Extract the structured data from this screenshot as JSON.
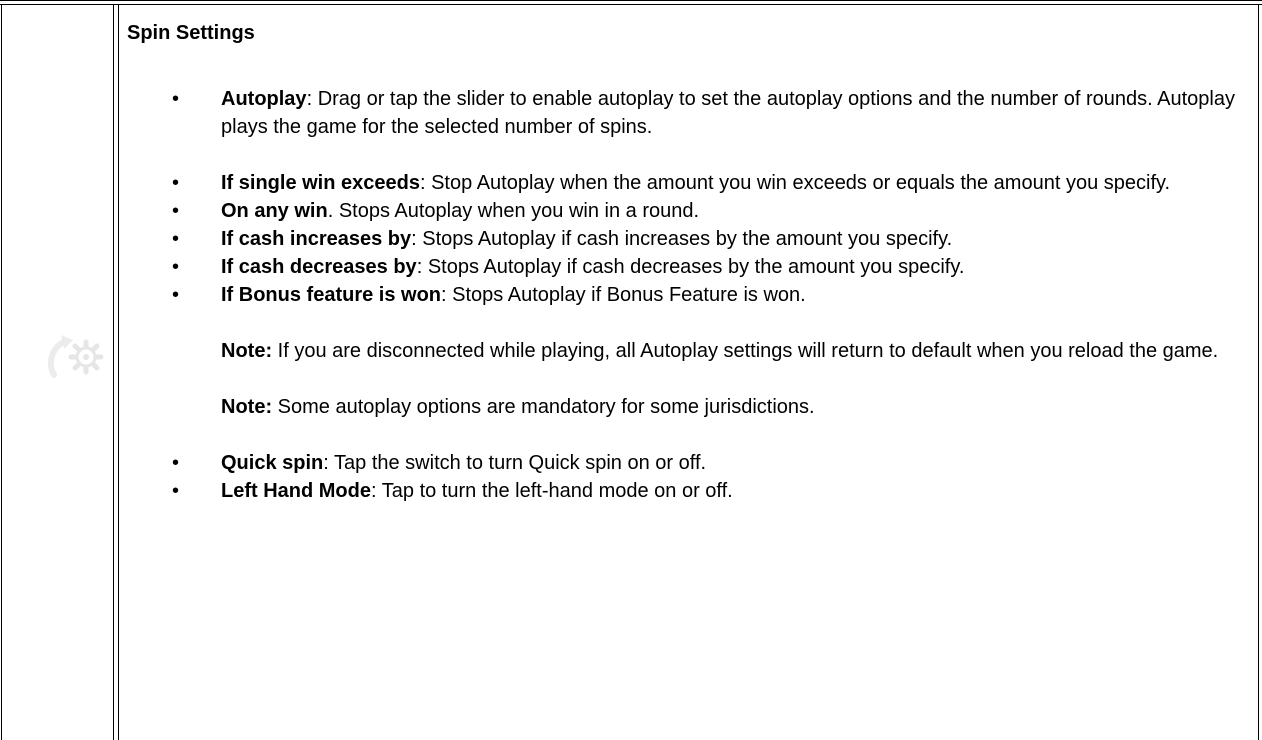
{
  "section": {
    "title": "Spin Settings",
    "icon": "autoplay-gear-icon"
  },
  "items_group1": [
    {
      "term": "Autoplay",
      "sep": ": ",
      "text": "Drag or tap the slider to enable autoplay to set the autoplay options and the number of rounds. Autoplay plays the game for the selected number of spins."
    }
  ],
  "items_group2": [
    {
      "term": "If single win exceeds",
      "sep": ": ",
      "text": "Stop Autoplay when the amount you win exceeds or equals the amount you specify."
    },
    {
      "term": "On any win",
      "sep": ". ",
      "text": "Stops Autoplay when you win in a round."
    },
    {
      "term": "If cash increases by",
      "sep": ": ",
      "text": "Stops Autoplay if cash increases by the amount you specify."
    },
    {
      "term": "If cash decreases by",
      "sep": ": ",
      "text": "Stops Autoplay if cash decreases by the amount you specify."
    },
    {
      "term": "If Bonus feature is won",
      "sep": ": ",
      "text": "Stops Autoplay if Bonus Feature is won."
    }
  ],
  "notes": [
    {
      "label": "Note:",
      "text": " If you are disconnected while playing, all Autoplay settings will return to default when you reload the game."
    },
    {
      "label": "Note:",
      "text": " Some autoplay options are mandatory for some jurisdictions."
    }
  ],
  "items_group3": [
    {
      "term": "Quick spin",
      "sep": ": ",
      "text": "Tap the switch to turn Quick spin on or off."
    },
    {
      "term": "Left Hand Mode",
      "sep": ": ",
      "text": "Tap to turn the left-hand mode on or off."
    }
  ]
}
